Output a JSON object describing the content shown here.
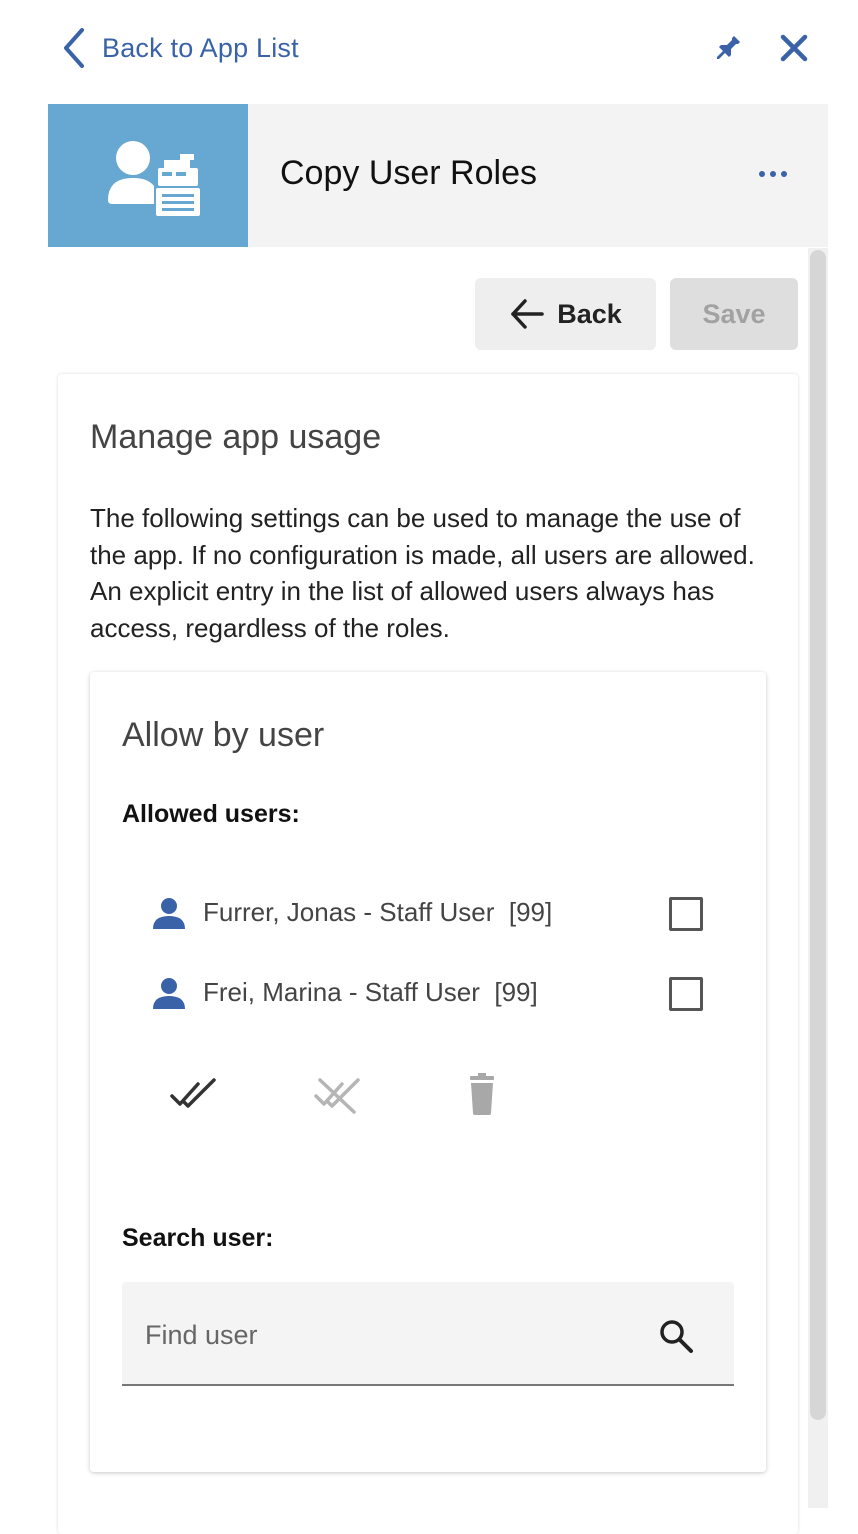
{
  "nav": {
    "back_label": "Back to App List"
  },
  "app": {
    "title": "Copy User Roles"
  },
  "toolbar": {
    "back_label": "Back",
    "save_label": "Save"
  },
  "manage": {
    "title": "Manage app usage",
    "description": "The following settings can be used to manage the use of the app. If no configuration is made, all users are allowed. An explicit entry in the list of allowed users always has access, regardless of the roles."
  },
  "allow_by_user": {
    "title": "Allow by user",
    "allowed_label": "Allowed users:",
    "users": [
      {
        "name": "Furrer, Jonas - Staff User  [99]",
        "checked": false
      },
      {
        "name": "Frei, Marina - Staff User  [99]",
        "checked": false
      }
    ],
    "search_label": "Search user:",
    "search_placeholder": "Find user",
    "search_value": ""
  },
  "colors": {
    "accent_blue": "#3a62a8",
    "app_tile": "#66a8d2",
    "panel_bg": "#f3f3f3"
  },
  "icons": [
    "chevron-left-icon",
    "pin-icon",
    "close-icon",
    "more-icon",
    "arrow-left-icon",
    "user-icon",
    "check-all-icon",
    "uncheck-all-icon",
    "trash-icon",
    "search-icon"
  ]
}
